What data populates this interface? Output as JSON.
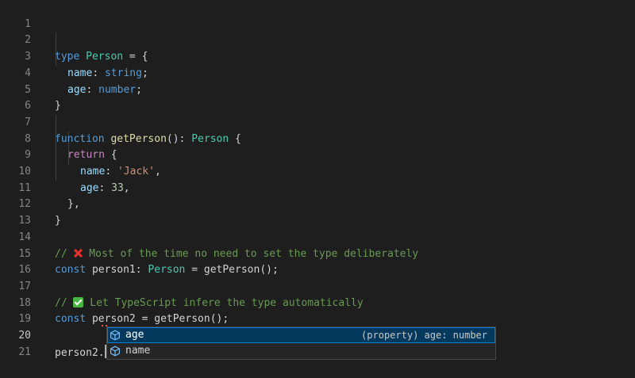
{
  "editor": {
    "active_line": "20",
    "lines": [
      {
        "n": "1"
      },
      {
        "n": "2",
        "t": [
          "type",
          " ",
          "Person",
          " = {"
        ]
      },
      {
        "n": "3",
        "t": [
          "name",
          ": ",
          "string",
          ";"
        ]
      },
      {
        "n": "4",
        "t": [
          "age",
          ": ",
          "number",
          ";"
        ]
      },
      {
        "n": "5",
        "t": [
          "}"
        ]
      },
      {
        "n": "6"
      },
      {
        "n": "7",
        "t": [
          "function",
          " ",
          "getPerson",
          "(): ",
          "Person",
          " {"
        ]
      },
      {
        "n": "8",
        "t": [
          "return",
          " {"
        ]
      },
      {
        "n": "9",
        "t": [
          "name",
          ": ",
          "'Jack'",
          ","
        ]
      },
      {
        "n": "10",
        "t": [
          "age",
          ": ",
          "33",
          ","
        ]
      },
      {
        "n": "11",
        "t": [
          "},"
        ]
      },
      {
        "n": "12",
        "t": [
          "}"
        ]
      },
      {
        "n": "13"
      },
      {
        "n": "14",
        "t": [
          "// ",
          "❌",
          " Most of the time no need to set the type deliberately"
        ]
      },
      {
        "n": "15",
        "t": [
          "const",
          " ",
          "person1",
          ": ",
          "Person",
          " = ",
          "getPerson",
          "();"
        ]
      },
      {
        "n": "16"
      },
      {
        "n": "17",
        "t": [
          "// ",
          "✅",
          " Let TypeScript infere the type automatically"
        ]
      },
      {
        "n": "18",
        "t": [
          "const",
          " ",
          "person2",
          " = ",
          "getPerson",
          "();"
        ]
      },
      {
        "n": "19"
      },
      {
        "n": "20",
        "t": [
          "person2",
          "."
        ]
      },
      {
        "n": "21"
      }
    ]
  },
  "suggest": {
    "items": [
      {
        "icon": "property-cube-icon",
        "label": "age",
        "detail": "(property) age: number",
        "selected": true
      },
      {
        "icon": "property-cube-icon",
        "label": "name",
        "detail": "",
        "selected": false
      }
    ]
  },
  "colors": {
    "background": "#1e1e1e",
    "keyword": "#569cd6",
    "type": "#4ec9b0",
    "string": "#ce9178",
    "number": "#b5cea8",
    "comment": "#6a9955",
    "selection": "#04395e",
    "focus_border": "#007fd4"
  }
}
